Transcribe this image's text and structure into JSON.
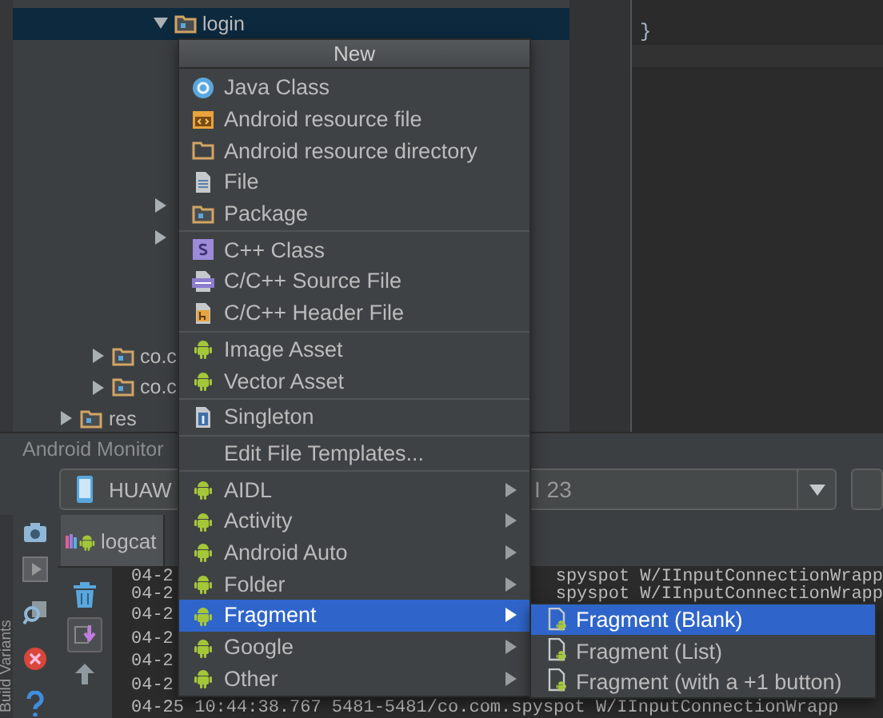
{
  "tree": [
    {
      "children": [
        {
          "children": [
            {
              "children": [
                {
                  "label": "login",
                  "expanded": true,
                  "selected": true
                },
                {
                  "expanded": false
                },
                {
                  "expanded": false
                }
              ]
            }
          ]
        },
        {
          "label": "co.c",
          "expanded": false,
          "selected": false
        },
        {
          "label": "co.c",
          "expanded": false,
          "selected": false
        }
      ]
    },
    {
      "label": "res",
      "expanded": false,
      "selected": false
    }
  ],
  "editor": {
    "lines": [
      "}"
    ]
  },
  "monitor": {
    "title": "Android Monitor",
    "device_selector": {
      "text_start": "HUAW",
      "text_end": "I 23"
    },
    "side_label": "Build Variants",
    "tabs": [
      {
        "label": "logcat",
        "selected": true
      }
    ],
    "log_lines": [
      {
        "start": "04-2",
        "end": "spyspot W/IInputConnectionWrapp"
      },
      {
        "start": "04-2",
        "end": "spyspot W/IInputConnectionWrapp"
      },
      {
        "start": "04-2"
      },
      {
        "start": "04-2"
      },
      {
        "start": "04-2"
      },
      {
        "start": "04-2"
      },
      {
        "start": "04-25 10:44:38.767 5481-5481/co.com.spyspot W/IInputConnectionWrapp"
      }
    ]
  },
  "new_menu": {
    "title": "New",
    "groups": [
      [
        {
          "label": "Java Class",
          "kind": "class",
          "selected": false,
          "submenu": false
        },
        {
          "label": "Android resource file",
          "kind": "resource_file",
          "selected": false,
          "submenu": false
        },
        {
          "label": "Android resource directory",
          "kind": "folder",
          "selected": false,
          "submenu": false
        },
        {
          "label": "File",
          "kind": "file",
          "selected": false,
          "submenu": false
        },
        {
          "label": "Package",
          "kind": "package",
          "selected": false,
          "submenu": false
        }
      ],
      [
        {
          "label": "C++ Class",
          "kind": "cpp_class",
          "selected": false,
          "submenu": false
        },
        {
          "label": "C/C++ Source File",
          "kind": "cpp_source",
          "selected": false,
          "submenu": false
        },
        {
          "label": "C/C++ Header File",
          "kind": "cpp_header",
          "selected": false,
          "submenu": false
        }
      ],
      [
        {
          "label": "Image Asset",
          "kind": "android",
          "selected": false,
          "submenu": false
        },
        {
          "label": "Vector Asset",
          "kind": "android",
          "selected": false,
          "submenu": false
        }
      ],
      [
        {
          "label": "Singleton",
          "kind": "singleton",
          "selected": false,
          "submenu": false
        }
      ],
      [
        {
          "label": "Edit File Templates...",
          "kind": "none",
          "selected": false,
          "submenu": false
        }
      ],
      [
        {
          "label": "AIDL",
          "kind": "android",
          "selected": false,
          "submenu": true
        },
        {
          "label": "Activity",
          "kind": "android",
          "selected": false,
          "submenu": true
        },
        {
          "label": "Android Auto",
          "kind": "android",
          "selected": false,
          "submenu": true
        },
        {
          "label": "Folder",
          "kind": "android",
          "selected": false,
          "submenu": true
        },
        {
          "label": "Fragment",
          "kind": "android",
          "selected": true,
          "submenu": true
        },
        {
          "label": "Google",
          "kind": "android",
          "selected": false,
          "submenu": true
        },
        {
          "label": "Other",
          "kind": "android",
          "selected": false,
          "submenu": true
        }
      ]
    ]
  },
  "submenu": {
    "items": [
      {
        "label": "Fragment (Blank)",
        "kind": "fragment",
        "selected": true
      },
      {
        "label": "Fragment (List)",
        "kind": "fragment",
        "selected": false
      },
      {
        "label": "Fragment (with a +1 button)",
        "kind": "fragment",
        "selected": false
      }
    ]
  }
}
